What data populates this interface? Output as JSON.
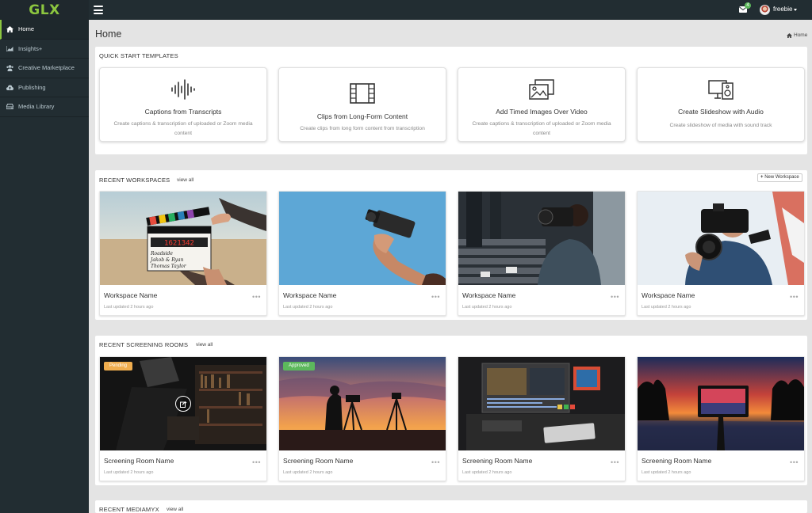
{
  "brand": {
    "logo": "GLX",
    "logo_color": "#8cc63f"
  },
  "topbar": {
    "menu_icon": "hamburger-icon",
    "mail_icon": "envelope-icon",
    "mail_badge": "4",
    "user_name": "freebie"
  },
  "sidebar": {
    "items": [
      {
        "label": "Home",
        "icon": "home-icon",
        "active": true
      },
      {
        "label": "Insights+",
        "icon": "chart-icon",
        "active": false
      },
      {
        "label": "Creative Marketplace",
        "icon": "users-icon",
        "active": false
      },
      {
        "label": "Publishing",
        "icon": "cloud-upload-icon",
        "active": false
      },
      {
        "label": "Media Library",
        "icon": "hdd-icon",
        "active": false
      }
    ]
  },
  "page": {
    "title": "Home",
    "breadcrumb": "Home"
  },
  "quick_start": {
    "title": "QUICK START TEMPLATES",
    "cards": [
      {
        "title": "Captions from Transcripts",
        "desc": "Create captions & transcription of uploaded or Zoom media content",
        "icon": "audio-wave-icon"
      },
      {
        "title": "Clips from Long-Form Content",
        "desc": "Create clips from long form content from transcription",
        "icon": "film-icon"
      },
      {
        "title": "Add Timed Images Over Video",
        "desc": "Create captions & transcription of uploaded or Zoom media content",
        "icon": "images-icon"
      },
      {
        "title": "Create Slideshow with Audio",
        "desc": "Create slideshow of media with sound track",
        "icon": "slideshow-speaker-icon"
      }
    ]
  },
  "workspaces": {
    "title": "RECENT WORKSPACES",
    "view_all": "view all",
    "new_button": "New Workspace",
    "items": [
      {
        "name": "Workspace Name",
        "updated": "Last updated 2 hours ago"
      },
      {
        "name": "Workspace Name",
        "updated": "Last updated 2 hours ago"
      },
      {
        "name": "Workspace Name",
        "updated": "Last updated 2 hours ago"
      },
      {
        "name": "Workspace Name",
        "updated": "Last updated 2 hours ago"
      }
    ]
  },
  "screening": {
    "title": "RECENT SCREENING ROOMS",
    "view_all": "view all",
    "items": [
      {
        "name": "Screening Room Name",
        "updated": "Last updated 2 hours ago",
        "badge": "Pending",
        "badge_color": "#f0ad4e"
      },
      {
        "name": "Screening Room Name",
        "updated": "Last updated 2 hours ago",
        "badge": "Approved",
        "badge_color": "#5cb85c"
      },
      {
        "name": "Screening Room Name",
        "updated": "Last updated 2 hours ago"
      },
      {
        "name": "Screening Room Name",
        "updated": "Last updated 2 hours ago"
      }
    ]
  },
  "mediamyx": {
    "title": "RECENT MEDIAMYX",
    "view_all": "view all"
  },
  "clapper": {
    "digits": "1621342",
    "roll": "Roadside",
    "names": "Jakob & Ryan",
    "third": "Thomas Taylor"
  }
}
